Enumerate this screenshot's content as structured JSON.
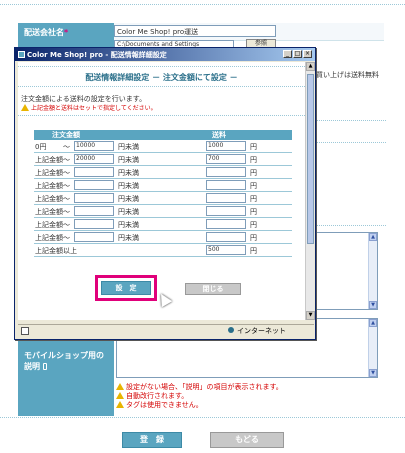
{
  "background_form": {
    "carrier_name_label": "配送会社名",
    "required_mark": "*",
    "carrier_name_value": "Color Me Shop! pro運送",
    "path_value": "C:\\Documents and Settings",
    "browse_button": "参照",
    "side_text": "買い上げは送料無料",
    "mobile_label_line1": "モバイルショップ用の",
    "mobile_label_line2": "説明",
    "warnings": [
      "設定がない場合、「説明」の項目が表示されます。",
      "自動改行されます。",
      "タグは使用できません。"
    ],
    "register_button": "登　録",
    "back_button": "もどる"
  },
  "popup": {
    "window_title": "Color Me Shop! pro - 配送情報詳細設定",
    "heading": "配送情報詳細設定 － 注文金額にて設定 －",
    "description": "注文金額による送料の設定を行います。",
    "warning": "上記金額と送料はセットで指定してください。",
    "table": {
      "col_amount": "注文金額",
      "col_fee": "送料",
      "yen": "円",
      "under": "円未満",
      "rows": [
        {
          "prefix": "0円",
          "tilde": "～",
          "amount": "10000",
          "fee": "1000"
        },
        {
          "prefix": "上記金額～",
          "tilde": "",
          "amount": "20000",
          "fee": "700"
        },
        {
          "prefix": "上記金額～",
          "tilde": "",
          "amount": "",
          "fee": ""
        },
        {
          "prefix": "上記金額～",
          "tilde": "",
          "amount": "",
          "fee": ""
        },
        {
          "prefix": "上記金額～",
          "tilde": "",
          "amount": "",
          "fee": ""
        },
        {
          "prefix": "上記金額～",
          "tilde": "",
          "amount": "",
          "fee": ""
        },
        {
          "prefix": "上記金額～",
          "tilde": "",
          "amount": "",
          "fee": ""
        },
        {
          "prefix": "上記金額～",
          "tilde": "",
          "amount": "",
          "fee": ""
        }
      ],
      "last_row_label": "上記金額以上",
      "last_row_fee": "500"
    },
    "set_button": "設　定",
    "close_button": "閉じる",
    "status_zone": "インターネット"
  },
  "colors": {
    "accent": "#5aa5c0",
    "highlight": "#e0007a",
    "warning_text": "#d40000"
  }
}
